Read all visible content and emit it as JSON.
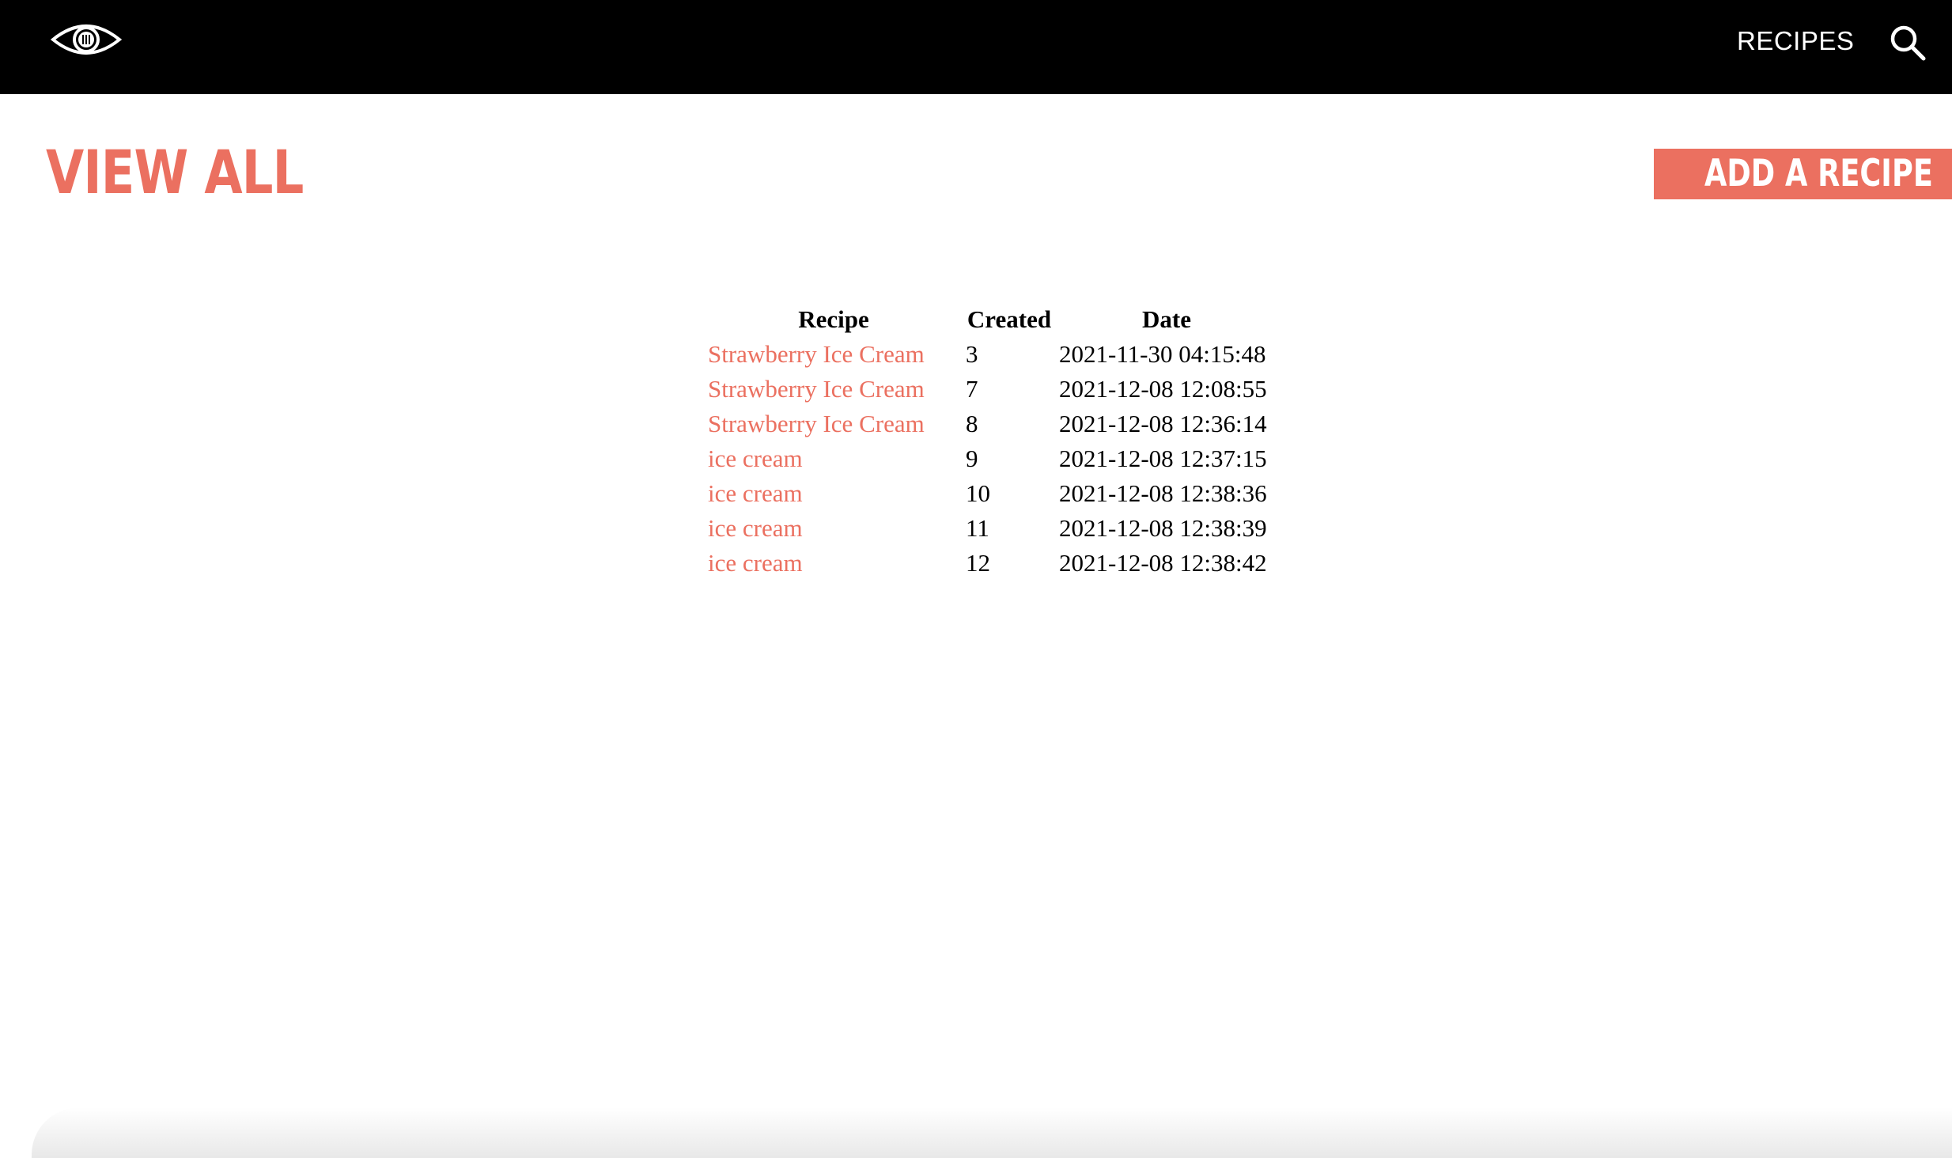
{
  "header": {
    "logo_icon": "eye-logo-icon",
    "nav_recipes": "RECIPES",
    "search_icon": "search-icon"
  },
  "page": {
    "title": "VIEW ALL",
    "add_button_label": "ADD A RECIPE"
  },
  "table": {
    "headers": [
      "Recipe",
      "Created",
      "Date"
    ],
    "rows": [
      {
        "recipe": "Strawberry Ice Cream",
        "created": "3",
        "date": "2021-11-30 04:15:48"
      },
      {
        "recipe": "Strawberry Ice Cream",
        "created": "7",
        "date": "2021-12-08 12:08:55"
      },
      {
        "recipe": "Strawberry Ice Cream",
        "created": "8",
        "date": "2021-12-08 12:36:14"
      },
      {
        "recipe": "ice cream",
        "created": "9",
        "date": "2021-12-08 12:37:15"
      },
      {
        "recipe": "ice cream",
        "created": "10",
        "date": "2021-12-08 12:38:36"
      },
      {
        "recipe": "ice cream",
        "created": "11",
        "date": "2021-12-08 12:38:39"
      },
      {
        "recipe": "ice cream",
        "created": "12",
        "date": "2021-12-08 12:38:42"
      }
    ]
  },
  "colors": {
    "accent": "#EB7060",
    "header_bg": "#000000",
    "text": "#000000"
  }
}
